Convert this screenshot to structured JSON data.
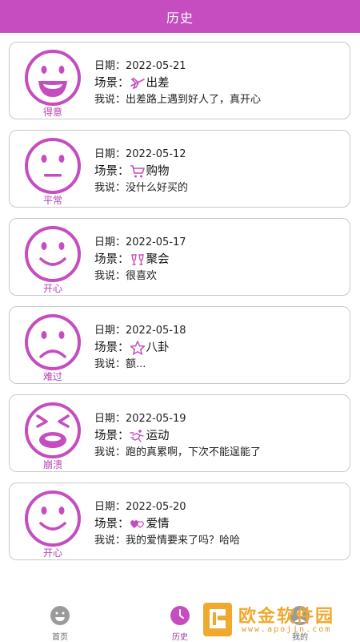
{
  "header": {
    "title": "历史"
  },
  "labels": {
    "date_prefix": "日期：",
    "scene_prefix": "场景：",
    "say_prefix": "我说："
  },
  "records": [
    {
      "mood": "得意",
      "face": "grin",
      "date": "2022-05-21",
      "scene_icon": "airplane-icon",
      "scene": "出差",
      "say": "出差路上遇到好人了，真开心"
    },
    {
      "mood": "平常",
      "face": "neutral",
      "date": "2022-05-12",
      "scene_icon": "shopping-cart-icon",
      "scene": "购物",
      "say": "没什么好买的"
    },
    {
      "mood": "开心",
      "face": "smile",
      "date": "2022-05-17",
      "scene_icon": "cheers-glasses-icon",
      "scene": "聚会",
      "say": "很喜欢"
    },
    {
      "mood": "难过",
      "face": "sad",
      "date": "2022-05-18",
      "scene_icon": "star-icon",
      "scene": "八卦",
      "say": "额..."
    },
    {
      "mood": "崩溃",
      "face": "crying",
      "date": "2022-05-19",
      "scene_icon": "running-icon",
      "scene": "运动",
      "say": "跑的真累啊，下次不能逞能了"
    },
    {
      "mood": "开心",
      "face": "smile",
      "date": "2022-05-20",
      "scene_icon": "hearts-icon",
      "scene": "爱情",
      "say": "我的爱情要来了吗？哈哈"
    }
  ],
  "tabbar": {
    "tabs": [
      {
        "label": "首页",
        "icon": "smiley-home-icon",
        "active": false
      },
      {
        "label": "历史",
        "icon": "clock-icon",
        "active": true
      },
      {
        "label": "我的",
        "icon": "profile-icon",
        "active": false
      }
    ]
  },
  "watermark": {
    "text": "欧金软件园",
    "url": "www.apojin.com"
  },
  "colors": {
    "accent": "#c54dbf",
    "face": "#c54dbf",
    "mood_text": "#b83fb2",
    "border": "#c9c9c9"
  }
}
